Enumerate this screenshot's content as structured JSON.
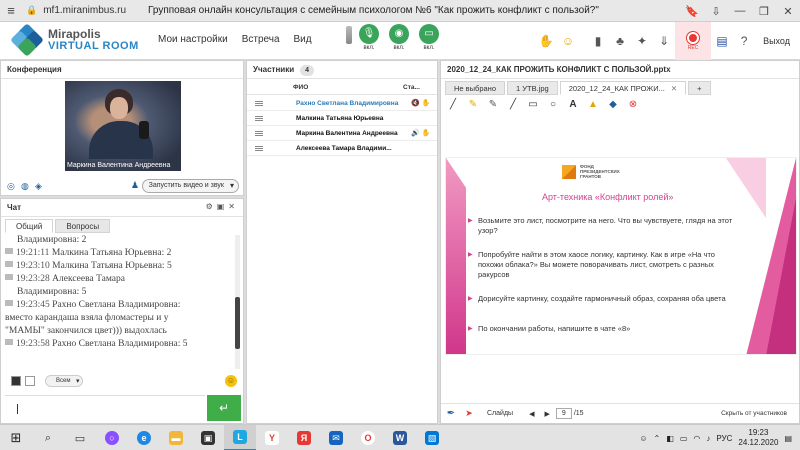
{
  "browser": {
    "url": "mf1.miranimbus.ru",
    "title": "Групповая онлайн консультация с семейным психологом №6 \"Как прожить конфликт с пользой?\""
  },
  "app": {
    "logo_line1": "Mirapolis",
    "logo_line2": "VIRTUAL ROOM",
    "menu": [
      "Мои настройки",
      "Встреча",
      "Вид"
    ],
    "media": [
      {
        "label": "вкл.",
        "icon": "microphone-icon"
      },
      {
        "label": "вкл.",
        "icon": "camera-icon"
      },
      {
        "label": "вкл.",
        "icon": "screen-share-icon"
      }
    ],
    "rec_label": "REC",
    "exit_label": "Выход"
  },
  "conference": {
    "title": "Конференция",
    "video_name": "Маркина Валентина  Андреевна",
    "start_video_label": "Запустить видео и звук"
  },
  "chat": {
    "title": "Чат",
    "tabs": [
      "Общий",
      "Вопросы"
    ],
    "messages": [
      {
        "time": "",
        "text": "Владимировна: 2",
        "continuation": true
      },
      {
        "time": "19:21:11",
        "text": "Малкина Татьяна  Юрьевна: 2"
      },
      {
        "time": "19:23:10",
        "text": "Малкина Татьяна  Юрьевна: 5"
      },
      {
        "time": "19:23:28",
        "text": "Алексеева    Тамара"
      },
      {
        "time": "",
        "text": "Владимировна: 5",
        "continuation": true
      },
      {
        "time": "19:23:45",
        "text": "Рахно Светлана  Владимировна:"
      },
      {
        "time": "",
        "text": "вместо карандаша взяла фломастеры и у",
        "continuation": true,
        "noindent": true
      },
      {
        "time": "",
        "text": "\"МАМЫ\" закончился цвет))) выдохлась",
        "continuation": true,
        "noindent": true
      },
      {
        "time": "19:23:58",
        "text": "Рахно Светлана  Владимировна: 5"
      }
    ],
    "recipient": "Всем",
    "send_icon": "↵"
  },
  "participants": {
    "title": "Участники",
    "count": "4",
    "col_name": "ФИО",
    "col_status": "Ста...",
    "rows": [
      {
        "name": "Рахно Светлана  Владимировна",
        "host": true
      },
      {
        "name": "Малкина Татьяна  Юрьевна",
        "host": false
      },
      {
        "name": "Маркина Валентина  Андреевна",
        "host": false
      },
      {
        "name": "Алексеева   Тамара  Владими...",
        "host": false
      }
    ]
  },
  "presentation": {
    "title": "2020_12_24_КАК ПРОЖИТЬ КОНФЛИКТ С ПОЛЬЗОЙ.pptx",
    "tabs": [
      "Не выбрано",
      "1 УТВ.jpg",
      "2020_12_24_КАК ПРОЖИ...",
      "+"
    ],
    "slide": {
      "fund_text": [
        "ФОНД",
        "ПРЕЗИДЕНТСКИХ",
        "ГРАНТОВ"
      ],
      "title": "Арт-техника «Конфликт ролей»",
      "bullets": [
        "Возьмите это лист, посмотрите на него. Что вы чувствуете, глядя на этот узор?",
        "Попробуйте найти в этом хаосе логику, картинку. Как в игре «На что похожи облака?» Вы можете поворачивать лист, смотреть с разных ракурсов",
        "Дорисуйте картинку, создайте гармоничный образ, сохраняя оба цвета",
        "По окончании работы, напишите в чате «8»"
      ]
    },
    "slides_label": "Слайды",
    "page_current": "9",
    "page_total": "/15",
    "hide_label": "Скрыть от участников"
  },
  "taskbar": {
    "lang": "РУС",
    "time": "19:23",
    "date": "24.12.2020"
  },
  "colors": {
    "accent": "#2b86c5",
    "green": "#3fae49",
    "pink": "#d4418e",
    "rec": "#e53935"
  }
}
